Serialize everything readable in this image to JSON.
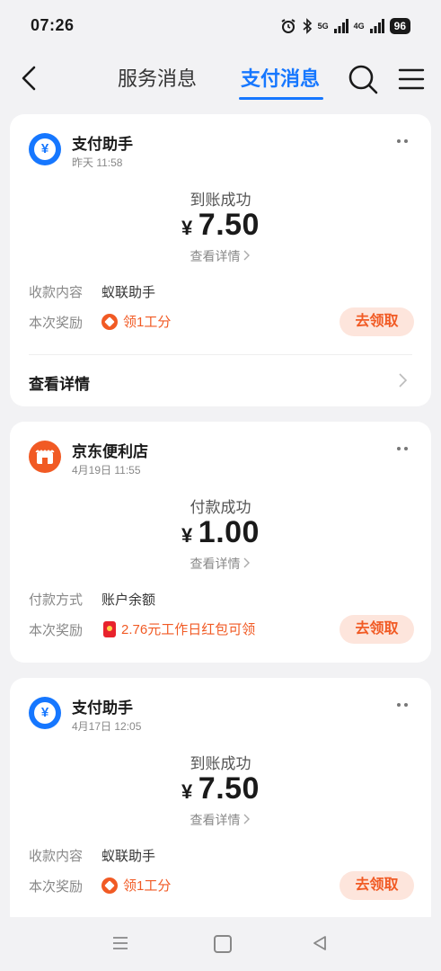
{
  "status_bar": {
    "time": "07:26",
    "battery": "96",
    "signal_1": "5G",
    "signal_2": "4G"
  },
  "nav": {
    "tab_service": "服务消息",
    "tab_payment": "支付消息"
  },
  "cards": [
    {
      "sender": "支付助手",
      "date": "昨天 11:58",
      "status": "到账成功",
      "currency": "¥",
      "amount": "7.50",
      "detail_link": "查看详情",
      "row_label": "收款内容",
      "row_value": "蚁联助手",
      "reward_label": "本次奖励",
      "reward_text": "领1工分",
      "claim_button": "去领取",
      "footer": "查看详情"
    },
    {
      "sender": "京东便利店",
      "date": "4月19日 11:55",
      "status": "付款成功",
      "currency": "¥",
      "amount": "1.00",
      "detail_link": "查看详情",
      "row_label": "付款方式",
      "row_value": "账户余额",
      "reward_label": "本次奖励",
      "reward_text": "2.76元工作日红包可领",
      "claim_button": "去领取"
    },
    {
      "sender": "支付助手",
      "date": "4月17日 12:05",
      "status": "到账成功",
      "currency": "¥",
      "amount": "7.50",
      "detail_link": "查看详情",
      "row_label": "收款内容",
      "row_value": "蚁联助手",
      "reward_label": "本次奖励",
      "reward_text": "领1工分",
      "claim_button": "去领取"
    }
  ],
  "colors": {
    "accent": "#1677ff",
    "orange": "#f15a24",
    "background": "#f2f2f4"
  }
}
